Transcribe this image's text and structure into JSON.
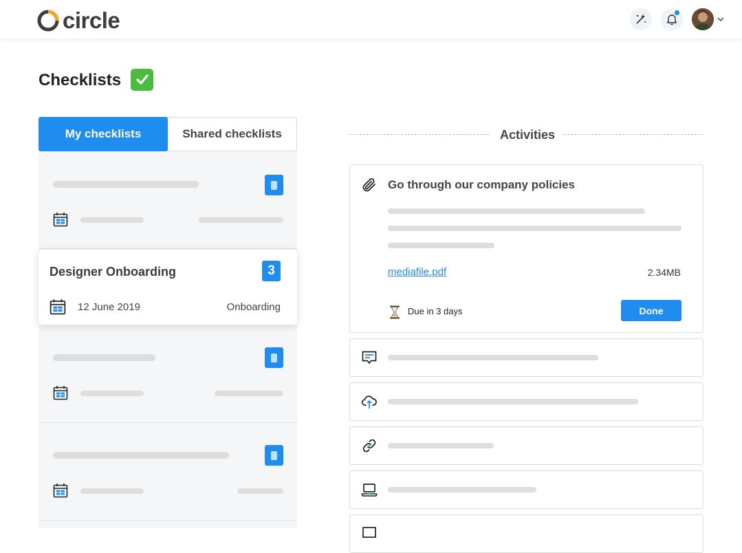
{
  "brand": {
    "name": "circle",
    "ring_color": "#f5a623",
    "text_color": "#3d3d3d"
  },
  "header": {
    "icons": [
      "magic-wand-icon",
      "bell-icon",
      "chevron-down-icon"
    ]
  },
  "page": {
    "title": "Checklists",
    "title_icon": "green-check-emoji"
  },
  "tabs": [
    {
      "label": "My checklists",
      "active": true
    },
    {
      "label": "Shared checklists",
      "active": false
    }
  ],
  "checklists": {
    "selected": {
      "title": "Designer Onboarding",
      "count": "3",
      "date": "12 June 2019",
      "category": "Onboarding"
    }
  },
  "activities": {
    "heading": "Activities",
    "main": {
      "title": "Go through our company policies",
      "file_name": "mediafile.pdf",
      "file_size": "2.34MB",
      "due": "Due in 3 days",
      "done_label": "Done"
    },
    "other_icons": [
      "chat-message-icon",
      "cloud-upload-icon",
      "link-icon",
      "laptop-icon",
      "message-icon"
    ]
  },
  "colors": {
    "accent": "#1f8df0",
    "skeleton": "#dddddd",
    "panel": "#f5f6f7"
  }
}
